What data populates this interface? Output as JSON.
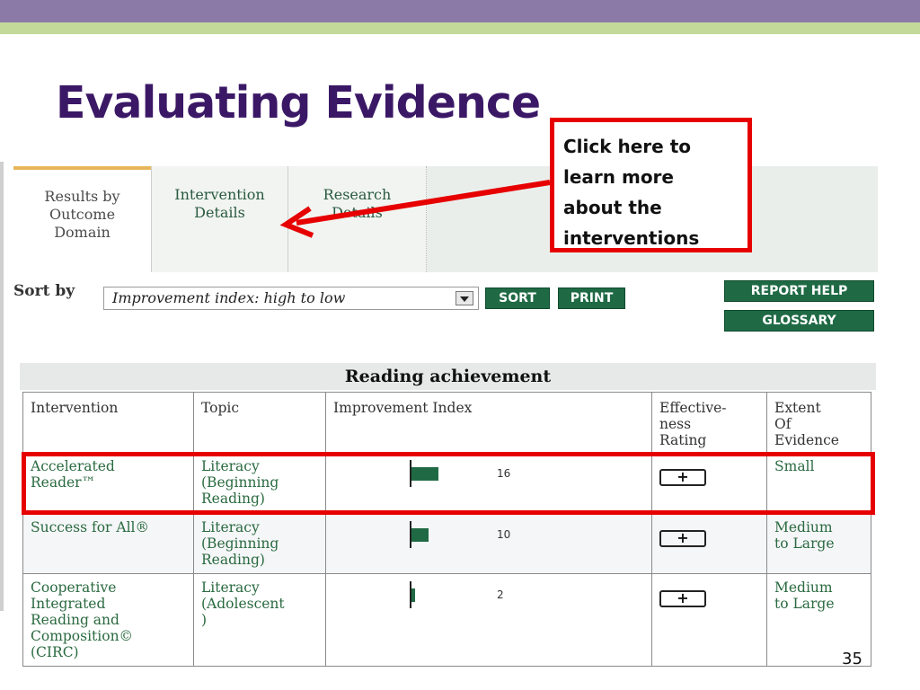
{
  "slide": {
    "title": "Evaluating Evidence",
    "page_number": "35",
    "callout_lines": [
      "Click here to",
      "learn more",
      "about the",
      "interventions"
    ]
  },
  "tabs": [
    {
      "label_lines": [
        "Results by",
        "Outcome",
        "Domain"
      ],
      "active": true
    },
    {
      "label_lines": [
        "Intervention",
        "Details"
      ],
      "active": false
    },
    {
      "label_lines": [
        "Research",
        "Details"
      ],
      "active": false
    }
  ],
  "controls": {
    "sort_label": "Sort by",
    "sort_selected": "Improvement index: high to low",
    "sort_button": "SORT",
    "print_button": "PRINT",
    "report_help_button": "REPORT HELP",
    "glossary_button": "GLOSSARY"
  },
  "table": {
    "title": "Reading achievement",
    "headers": {
      "intervention": "Intervention",
      "topic": "Topic",
      "improvement_index": "Improvement Index",
      "effectiveness_lines": [
        "Effective-",
        "ness",
        "Rating"
      ],
      "extent_lines": [
        "Extent",
        "Of",
        "Evidence"
      ]
    },
    "rows": [
      {
        "intervention_lines": [
          "Accelerated",
          "Reader™"
        ],
        "topic_lines": [
          "Literacy",
          "(Beginning",
          "Reading)"
        ],
        "index": 16,
        "index_label": "16",
        "rating": "+",
        "extent_lines": [
          "Small"
        ]
      },
      {
        "intervention_lines": [
          "Success for All®"
        ],
        "topic_lines": [
          "Literacy",
          "(Beginning",
          "Reading)"
        ],
        "index": 10,
        "index_label": "10",
        "rating": "+",
        "extent_lines": [
          "Medium",
          "to Large"
        ]
      },
      {
        "intervention_lines": [
          "Cooperative",
          "Integrated",
          "Reading and",
          "Composition©",
          "(CIRC)"
        ],
        "topic_lines": [
          "Literacy",
          "(Adolescent",
          ")"
        ],
        "index": 2,
        "index_label": "2",
        "rating": "+",
        "extent_lines": [
          "Medium",
          "to Large"
        ]
      }
    ]
  },
  "colors": {
    "title": "#3b1866",
    "accent_green": "#1f6a45",
    "highlight_red": "#e60000",
    "band_purple": "#8b7aa8",
    "band_green": "#c3d99a"
  }
}
